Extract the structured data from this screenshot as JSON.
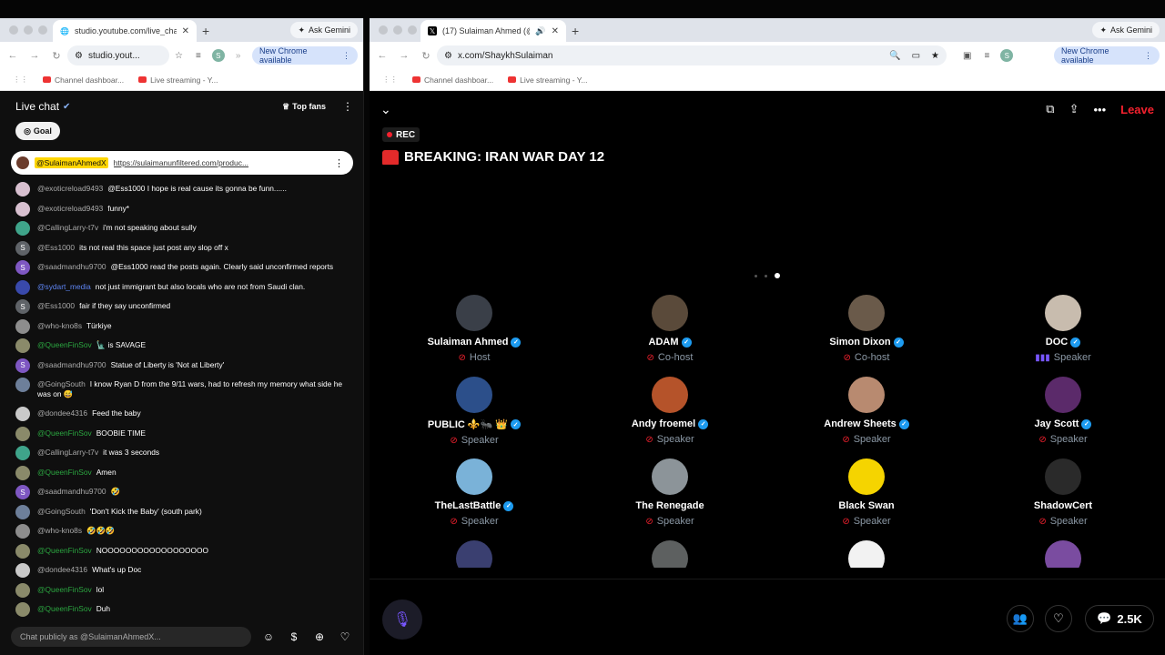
{
  "left_browser": {
    "tab_title": "studio.youtube.com/live_cha",
    "address": "studio.yout...",
    "new_chrome": "New Chrome available",
    "ask_gemini": "Ask Gemini",
    "profile_initial": "S",
    "bookmarks": [
      "Channel dashboar...",
      "Live streaming - Y..."
    ]
  },
  "chat": {
    "title": "Live chat",
    "top_fans": "Top fans",
    "goal": "Goal",
    "pinned": {
      "author": "@SulaimanAhmedX",
      "link": "https://sulaimanunfiltered.com/produc..."
    },
    "messages": [
      {
        "author": "@exoticreload9493",
        "text": "@Ess1000 I hope is real cause its gonna be funn......",
        "av": "",
        "color": "#d8c0d0",
        "type": "normal"
      },
      {
        "author": "@exoticreload9493",
        "text": "funny*",
        "av": "",
        "color": "#d8c0d0",
        "type": "normal"
      },
      {
        "author": "@CallingLarry-t7v",
        "text": "i'm not speaking about sully",
        "av": "",
        "color": "#3fa48a",
        "type": "normal"
      },
      {
        "author": "@Ess1000",
        "text": "its not real this space just post any slop off x",
        "av": "S",
        "color": "#5f6368",
        "type": "normal"
      },
      {
        "author": "@saadmandhu9700",
        "text": "@Ess1000 read the posts again. Clearly said unconfirmed reports",
        "av": "S",
        "color": "#7e57c2",
        "type": "normal"
      },
      {
        "author": "@sydart_media",
        "text": "not just immigrant but also locals who are not from Saudi clan.",
        "av": "",
        "color": "#3949ab",
        "type": "mod"
      },
      {
        "author": "@Ess1000",
        "text": "fair if they say unconfirmed",
        "av": "S",
        "color": "#5f6368",
        "type": "normal"
      },
      {
        "author": "@who-kno8s",
        "text": "Türkiye",
        "av": "",
        "color": "#8d8d8d",
        "type": "normal"
      },
      {
        "author": "@QueenFinSov",
        "text": "🗽 is SAVAGE",
        "av": "",
        "color": "#8a8a6a",
        "type": "member"
      },
      {
        "author": "@saadmandhu9700",
        "text": "Statue of Liberty is 'Not at Liberty'",
        "av": "S",
        "color": "#7e57c2",
        "type": "normal"
      },
      {
        "author": "@GoingSouth",
        "text": "I know Ryan D from the 9/11 wars, had to refresh my memory what side he was on 😅",
        "av": "",
        "color": "#6d7f9a",
        "type": "normal"
      },
      {
        "author": "@dondee4316",
        "text": "Feed the baby",
        "av": "",
        "color": "#c9c9c9",
        "type": "normal"
      },
      {
        "author": "@QueenFinSov",
        "text": "BOOBIE TIME",
        "av": "",
        "color": "#8a8a6a",
        "type": "member"
      },
      {
        "author": "@CallingLarry-t7v",
        "text": "it was 3 seconds",
        "av": "",
        "color": "#3fa48a",
        "type": "normal"
      },
      {
        "author": "@QueenFinSov",
        "text": "Amen",
        "av": "",
        "color": "#8a8a6a",
        "type": "member"
      },
      {
        "author": "@saadmandhu9700",
        "text": "🤣",
        "av": "S",
        "color": "#7e57c2",
        "type": "normal"
      },
      {
        "author": "@GoingSouth",
        "text": "'Don't Kick the Baby' (south park)",
        "av": "",
        "color": "#6d7f9a",
        "type": "normal"
      },
      {
        "author": "@who-kno8s",
        "text": "🤣🤣🤣",
        "av": "",
        "color": "#8d8d8d",
        "type": "normal"
      },
      {
        "author": "@QueenFinSov",
        "text": "NOOOOOOOOOOOOOOOOOO",
        "av": "",
        "color": "#8a8a6a",
        "type": "member"
      },
      {
        "author": "@dondee4316",
        "text": "What's up Doc",
        "av": "",
        "color": "#c9c9c9",
        "type": "normal"
      },
      {
        "author": "@QueenFinSov",
        "text": "lol",
        "av": "",
        "color": "#8a8a6a",
        "type": "member"
      },
      {
        "author": "@QueenFinSov",
        "text": "Duh",
        "av": "",
        "color": "#8a8a6a",
        "type": "member"
      }
    ],
    "input_placeholder": "Chat publicly as @SulaimanAhmedX..."
  },
  "right_browser": {
    "tab_title": "(17) Sulaiman Ahmed (@S",
    "address": "x.com/ShaykhSulaiman",
    "new_chrome": "New Chrome available",
    "ask_gemini": "Ask Gemini",
    "profile_initial": "S",
    "bookmarks": [
      "Channel dashboar...",
      "Live streaming - Y..."
    ]
  },
  "space": {
    "rec": "REC",
    "title": "BREAKING: IRAN WAR DAY 12",
    "leave": "Leave",
    "listener_count": "2.5K",
    "speakers": [
      {
        "name": "Sulaiman Ahmed",
        "role": "Host",
        "verified": true,
        "state": "muted",
        "color": "#3a3f48"
      },
      {
        "name": "ADAM",
        "role": "Co-host",
        "verified": true,
        "state": "muted",
        "color": "#5a4a3a"
      },
      {
        "name": "Simon Dixon",
        "role": "Co-host",
        "verified": true,
        "state": "muted",
        "color": "#6a5a4a"
      },
      {
        "name": "DOC",
        "role": "Speaker",
        "verified": true,
        "state": "speaking",
        "color": "#c8bcae"
      },
      {
        "name": "PUBLIC ⚜️🐜 👑",
        "role": "Speaker",
        "verified": true,
        "state": "muted",
        "color": "#2c4f8a"
      },
      {
        "name": "Andy froemel",
        "role": "Speaker",
        "verified": true,
        "state": "muted",
        "color": "#b5532a"
      },
      {
        "name": "Andrew Sheets",
        "role": "Speaker",
        "verified": true,
        "state": "muted",
        "color": "#b88a70"
      },
      {
        "name": "Jay Scott",
        "role": "Speaker",
        "verified": true,
        "state": "muted",
        "color": "#5b2a6a"
      },
      {
        "name": "TheLastBattle",
        "role": "Speaker",
        "verified": true,
        "state": "muted",
        "color": "#7ab2d8"
      },
      {
        "name": "The Renegade",
        "role": "Speaker",
        "verified": false,
        "state": "muted",
        "color": "#8c9499"
      },
      {
        "name": "Black Swan",
        "role": "Speaker",
        "verified": false,
        "state": "muted",
        "color": "#f5d400"
      },
      {
        "name": "ShadowCert",
        "role": "Speaker",
        "verified": false,
        "state": "muted",
        "color": "#2a2a2a"
      }
    ],
    "partial_avatars": [
      "#3a3f70",
      "#5d6060",
      "#f2f2f2",
      "#7a4ca0"
    ]
  },
  "icons": {
    "verified": "check-badge-icon",
    "muted": "mic-off-icon",
    "speaking": "audio-wave-icon"
  }
}
